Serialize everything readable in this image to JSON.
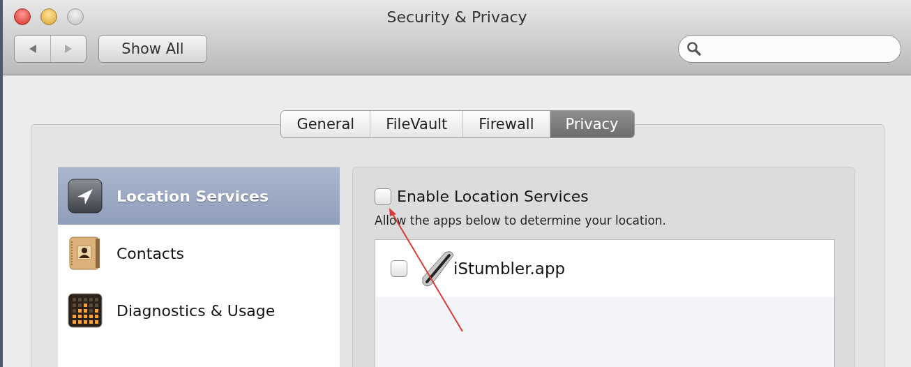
{
  "window": {
    "title": "Security & Privacy"
  },
  "toolbar": {
    "show_all": "Show All"
  },
  "tabs": [
    {
      "label": "General",
      "selected": false
    },
    {
      "label": "FileVault",
      "selected": false
    },
    {
      "label": "Firewall",
      "selected": false
    },
    {
      "label": "Privacy",
      "selected": true
    }
  ],
  "sidebar": {
    "items": [
      {
        "label": "Location Services",
        "selected": true
      },
      {
        "label": "Contacts",
        "selected": false
      },
      {
        "label": "Diagnostics & Usage",
        "selected": false
      }
    ]
  },
  "location": {
    "enable": {
      "label": "Enable Location Services",
      "checked": false
    },
    "description": "Allow the apps below to determine your location.",
    "apps": [
      {
        "name": "iStumbler.app",
        "checked": false
      }
    ]
  }
}
